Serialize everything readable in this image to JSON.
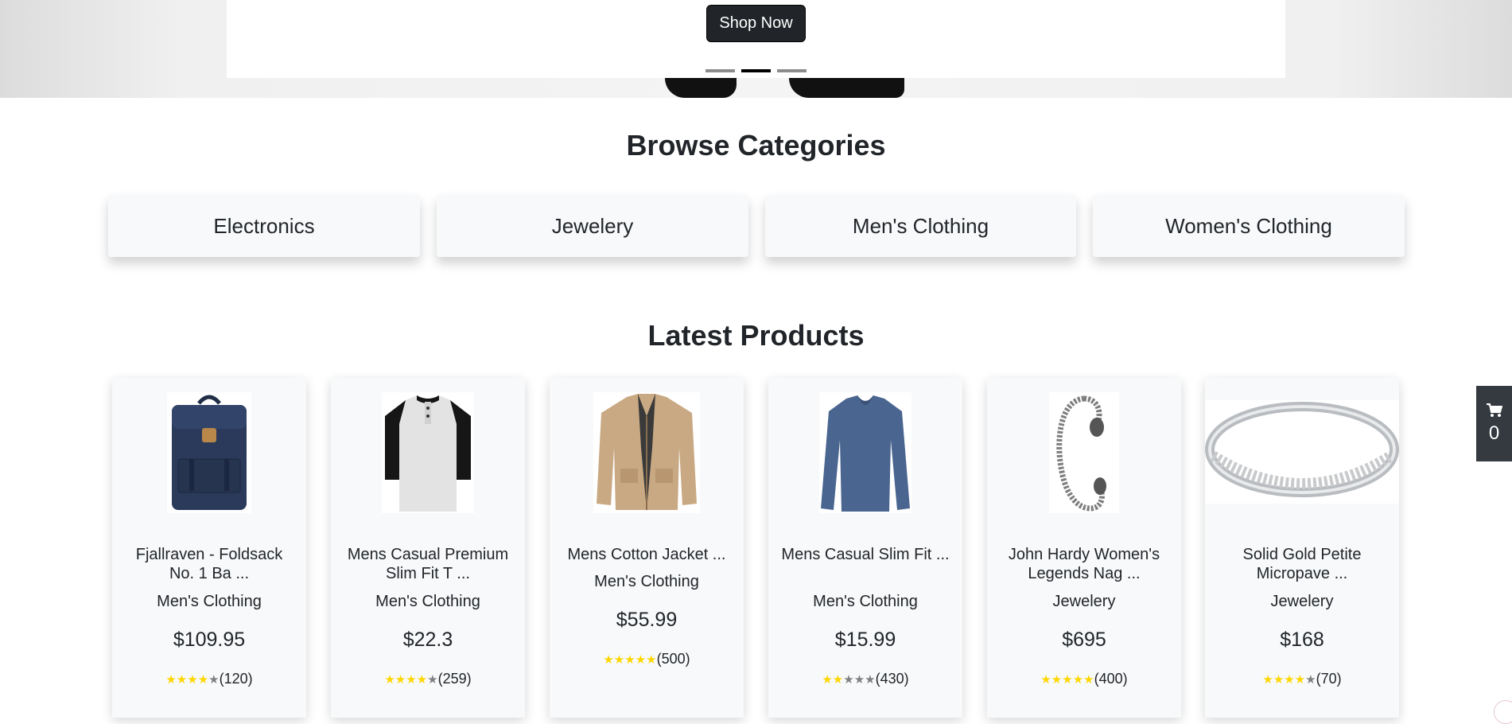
{
  "hero": {
    "button_label": "Shop Now",
    "slides": 3,
    "active_slide": 2
  },
  "browse": {
    "title": "Browse Categories",
    "categories": [
      "Electronics",
      "Jewelery",
      "Men's Clothing",
      "Women's Clothing"
    ]
  },
  "latest": {
    "title": "Latest Products",
    "products": [
      {
        "name": "Fjallraven - Foldsack No. 1 Ba ...",
        "category": "Men's Clothing",
        "price": "$109.95",
        "rating": 3.9,
        "count": "(120)",
        "image": "backpack"
      },
      {
        "name": "Mens Casual Premium Slim Fit T ...",
        "category": "Men's Clothing",
        "price": "$22.3",
        "rating": 4.1,
        "count": "(259)",
        "image": "henley-tee"
      },
      {
        "name": "Mens Cotton Jacket ...",
        "category": "Men's Clothing",
        "price": "$55.99",
        "rating": 4.7,
        "count": "(500)",
        "image": "cotton-jacket"
      },
      {
        "name": "Mens Casual Slim Fit ...",
        "category": "Men's Clothing",
        "price": "$15.99",
        "rating": 2.1,
        "count": "(430)",
        "image": "long-sleeve-tee"
      },
      {
        "name": "John Hardy Women's Legends Nag ...",
        "category": "Jewelery",
        "price": "$695",
        "rating": 4.6,
        "count": "(400)",
        "image": "bracelet"
      },
      {
        "name": "Solid Gold Petite Micropave ...",
        "category": "Jewelery",
        "price": "$168",
        "rating": 3.9,
        "count": "(70)",
        "image": "ring"
      }
    ]
  },
  "cart": {
    "icon": "cart-icon",
    "count": "0"
  },
  "colors": {
    "star_on": "#ffd700",
    "star_off": "#808080",
    "dark": "#212529",
    "cart_bg": "#343a40"
  }
}
